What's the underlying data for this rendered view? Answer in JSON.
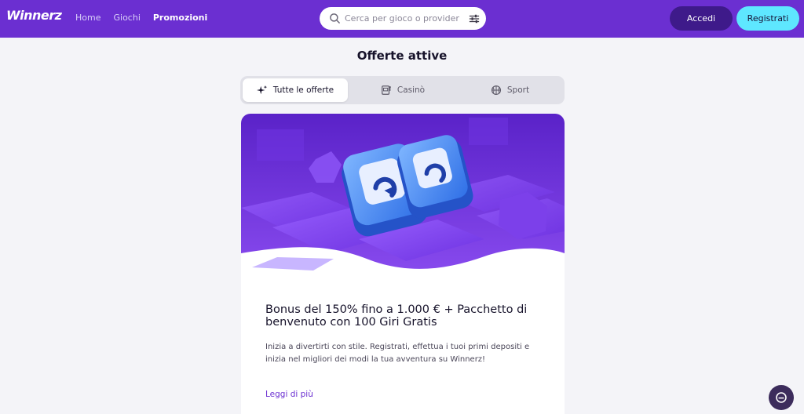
{
  "header": {
    "logo_text": "Winnerz",
    "nav": [
      {
        "label": "Home",
        "active": false
      },
      {
        "label": "Giochi",
        "active": false
      },
      {
        "label": "Promozioni",
        "active": true
      }
    ],
    "search": {
      "placeholder": "Cerca per gioco o provider",
      "value": ""
    },
    "login_label": "Accedi",
    "register_label": "Registrati"
  },
  "main": {
    "title": "Offerte attive",
    "tabs": [
      {
        "label": "Tutte le offerte",
        "icon": "sparkles-icon",
        "active": true
      },
      {
        "label": "Casinò",
        "icon": "slot-machine-icon",
        "active": false
      },
      {
        "label": "Sport",
        "icon": "ball-icon",
        "active": false
      }
    ],
    "promo": {
      "title": "Bonus del 150% fino a 1.000 € + Pacchetto di benvenuto con 100 Giri Gratis",
      "description": "Inizia a divertirti con stile. Registrati, effettua i tuoi primi depositi e inizia nel migliori dei modi la tua avventura su Winnerz!",
      "link_label": "Leggi di più"
    }
  },
  "colors": {
    "brand_purple": "#6b2fd1",
    "accent_cyan": "#5ee7ff",
    "login_bg": "#3e1a8a",
    "page_bg": "#f4f4f8"
  },
  "chat": {
    "icon": "chat-icon"
  }
}
